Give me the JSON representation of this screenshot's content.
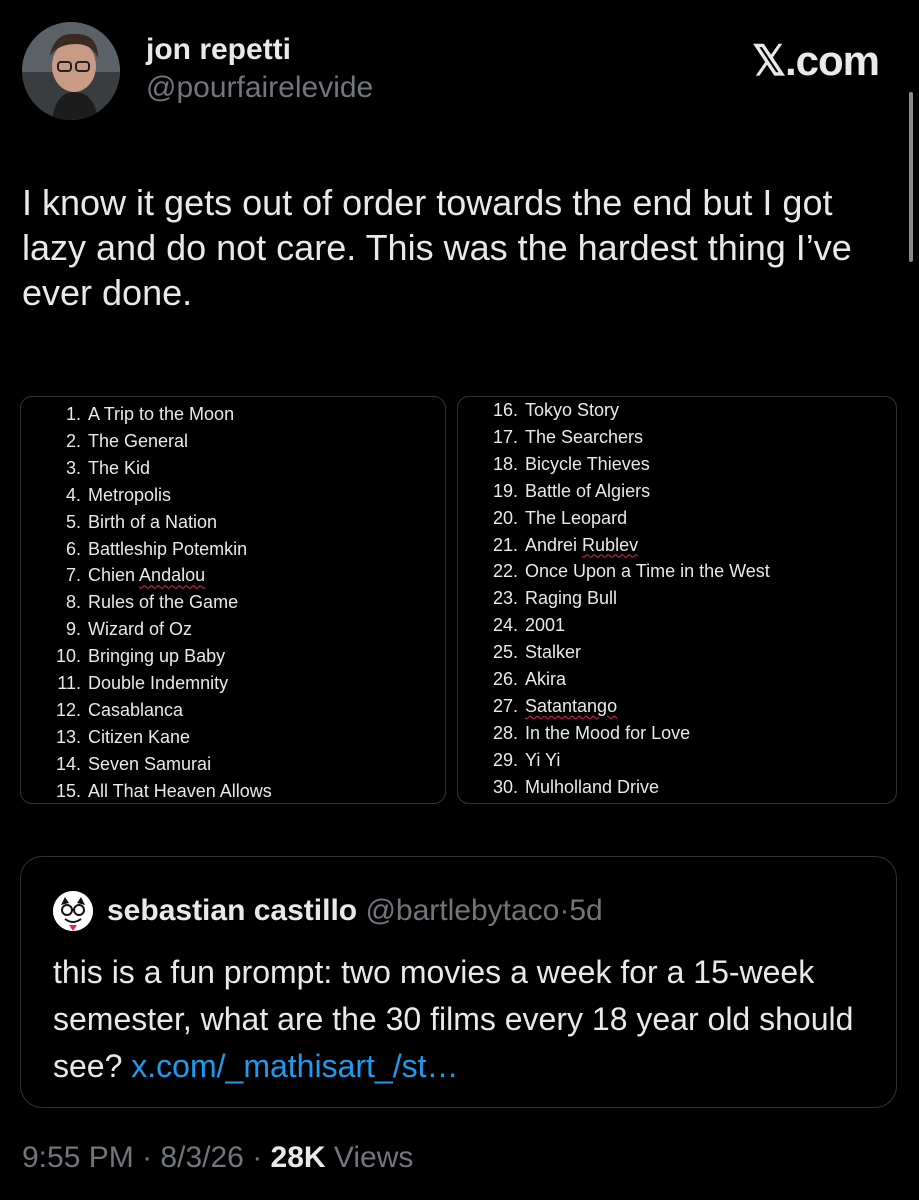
{
  "author": {
    "display_name": "jon repetti",
    "handle": "@pourfairelevide"
  },
  "brand": "𝕏.com",
  "tweet": {
    "text": "I know it gets out of order towards the end but I got lazy and do not care. This was the hardest thing I’ve ever done."
  },
  "list_left": [
    {
      "num": "1.",
      "title": "A Trip to the Moon"
    },
    {
      "num": "2.",
      "title": "The General"
    },
    {
      "num": "3.",
      "title": "The Kid"
    },
    {
      "num": "4.",
      "title": "Metropolis"
    },
    {
      "num": "5.",
      "title": "Birth of a Nation"
    },
    {
      "num": "6.",
      "title": "Battleship Potemkin"
    },
    {
      "num": "7.",
      "title": "Chien Andalou"
    },
    {
      "num": "8.",
      "title": "Rules of the Game"
    },
    {
      "num": "9.",
      "title": "Wizard of Oz"
    },
    {
      "num": "10.",
      "title": "Bringing up Baby"
    },
    {
      "num": "11.",
      "title": "Double Indemnity"
    },
    {
      "num": "12.",
      "title": "Casablanca"
    },
    {
      "num": "13.",
      "title": "Citizen Kane"
    },
    {
      "num": "14.",
      "title": "Seven Samurai"
    },
    {
      "num": "15.",
      "title": "All That Heaven Allows"
    }
  ],
  "list_right": [
    {
      "num": "16.",
      "title": "Tokyo Story"
    },
    {
      "num": "17.",
      "title": "The Searchers"
    },
    {
      "num": "18.",
      "title": "Bicycle Thieves"
    },
    {
      "num": "19.",
      "title": "Battle of Algiers"
    },
    {
      "num": "20.",
      "title": "The Leopard"
    },
    {
      "num": "21.",
      "title": "Andrei Rublev"
    },
    {
      "num": "22.",
      "title": "Once Upon a Time in the West"
    },
    {
      "num": "23.",
      "title": "Raging Bull"
    },
    {
      "num": "24.",
      "title": "2001"
    },
    {
      "num": "25.",
      "title": "Stalker"
    },
    {
      "num": "26.",
      "title": "Akira"
    },
    {
      "num": "27.",
      "title": "Satantango"
    },
    {
      "num": "28.",
      "title": "In the Mood for Love"
    },
    {
      "num": "29.",
      "title": "Yi Yi"
    },
    {
      "num": "30.",
      "title": "Mulholland Drive"
    }
  ],
  "quote": {
    "display_name": "sebastian castillo",
    "handle": "@bartlebytaco",
    "separator": "·",
    "time": "5d",
    "text": "this is a fun prompt: two movies a week for a 15-week semester, what are the 30 films every 18 year old should see?",
    "link": "x.com/_mathisart_/st…"
  },
  "meta": {
    "time": "9:55 PM",
    "sep1": "·",
    "date": "8/3/26",
    "sep2": "·",
    "views_count": "28K",
    "views_label": "Views"
  },
  "colors": {
    "background": "#000000",
    "text": "#e7e9ea",
    "muted": "#71767b",
    "link": "#1d9bf0",
    "border": "#333333"
  }
}
